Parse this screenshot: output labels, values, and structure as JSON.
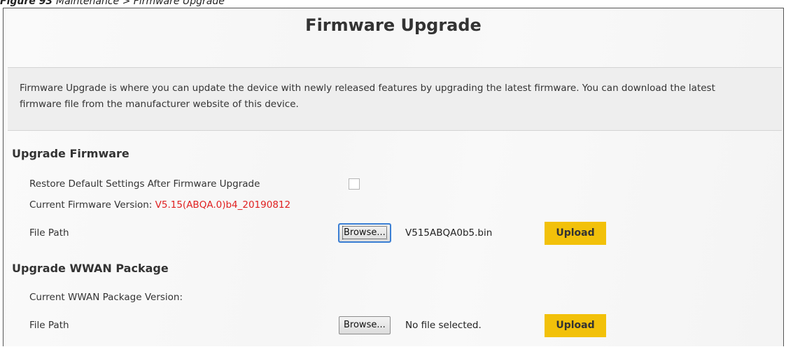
{
  "caption": {
    "figure_label": "Figure 93",
    "title": "Maintenance > Firmware Upgrade"
  },
  "page": {
    "title": "Firmware Upgrade",
    "description": "Firmware Upgrade is where you can update the device with newly released features by upgrading the latest firmware. You can download the latest firmware file from the manufacturer website of this device."
  },
  "upgrade_firmware": {
    "heading": "Upgrade Firmware",
    "restore_default_label": "Restore Default Settings After Firmware Upgrade",
    "restore_default_checked": false,
    "current_version_label": "Current Firmware Version: ",
    "current_version_value": "V5.15(ABQA.0)b4_20190812",
    "file_path_label": "File Path",
    "browse_label": "Browse...",
    "selected_file": "V515ABQA0b5.bin",
    "upload_label": "Upload"
  },
  "upgrade_wwan": {
    "heading": "Upgrade WWAN Package",
    "current_version_label": "Current WWAN Package Version:",
    "file_path_label": "File Path",
    "browse_label": "Browse...",
    "selected_file": "No file selected.",
    "upload_label": "Upload"
  },
  "colors": {
    "upload_button": "#f2c10a",
    "version_text": "#e02020",
    "focus_ring": "#3b7fd4"
  }
}
